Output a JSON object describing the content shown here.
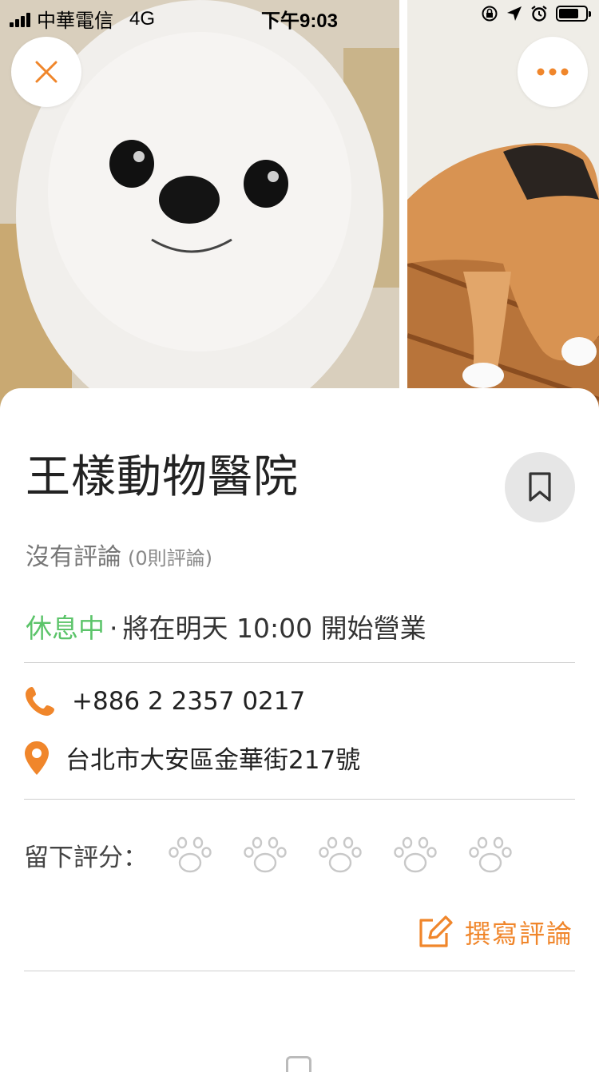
{
  "status_bar": {
    "carrier": "中華電信",
    "network": "4G",
    "time": "下午9:03",
    "battery_level": 0.75
  },
  "photos": [
    {
      "subject": "Pomeranian dog"
    },
    {
      "subject": "calico cat"
    }
  ],
  "top_buttons": {
    "close_icon": "close-icon",
    "more_icon": "more-icon"
  },
  "place": {
    "name": "王樣動物醫院",
    "reviews": {
      "summary": "沒有評論",
      "count_text": "(0則評論)"
    },
    "hours": {
      "status": "休息中",
      "separator": "·",
      "next_open": "將在明天 10:00 開始營業"
    },
    "phone": "+886 2 2357 0217",
    "address": "台北市大安區金華街217號",
    "rating": {
      "label": "留下評分：",
      "max": 5,
      "value": 0
    },
    "write_review_label": "撰寫評論"
  },
  "colors": {
    "accent": "#f0862b",
    "open_status": "#5cc46a",
    "paw_outline": "#c8c8c8",
    "bookmark_bg": "#e6e6e6"
  }
}
